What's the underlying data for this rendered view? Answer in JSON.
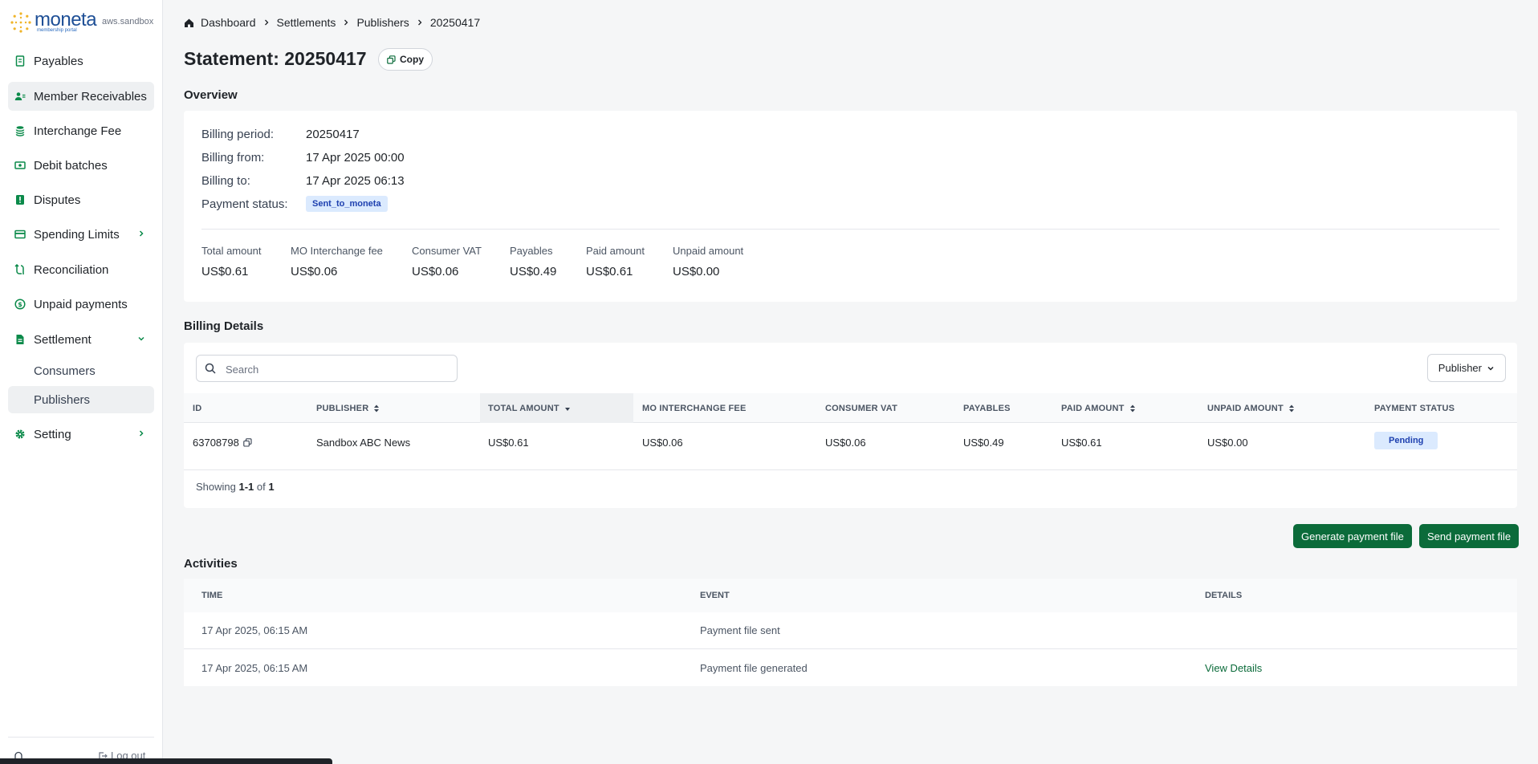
{
  "app": {
    "logo_text": "moneta",
    "logo_subtitle": "membership portal",
    "environment": "aws.sandbox"
  },
  "sidebar": {
    "items": [
      {
        "label": "Payables",
        "icon": "receipt-icon"
      },
      {
        "label": "Member Receivables",
        "icon": "users-icon",
        "active": true
      },
      {
        "label": "Interchange Fee",
        "icon": "coins-icon"
      },
      {
        "label": "Debit batches",
        "icon": "banknote-icon"
      },
      {
        "label": "Disputes",
        "icon": "alert-icon"
      },
      {
        "label": "Spending Limits",
        "icon": "credit-card-icon",
        "chevron": "right"
      },
      {
        "label": "Reconciliation",
        "icon": "arrows-icon"
      },
      {
        "label": "Unpaid payments",
        "icon": "dollar-circle-icon"
      },
      {
        "label": "Settlement",
        "icon": "document-icon",
        "chevron": "down"
      },
      {
        "label": "Setting",
        "icon": "gear-icon",
        "chevron": "right"
      }
    ],
    "settlement_sub": [
      {
        "label": "Consumers"
      },
      {
        "label": "Publishers",
        "active": true
      }
    ],
    "logout_label": "Log out"
  },
  "breadcrumb": [
    "Dashboard",
    "Settlements",
    "Publishers",
    "20250417"
  ],
  "page": {
    "title": "Statement: 20250417",
    "copy_label": "Copy"
  },
  "overview": {
    "heading": "Overview",
    "rows": [
      {
        "label": "Billing period:",
        "value": "20250417"
      },
      {
        "label": "Billing from:",
        "value": "17 Apr 2025 00:00"
      },
      {
        "label": "Billing to:",
        "value": "17 Apr 2025 06:13"
      },
      {
        "label": "Payment status:",
        "value": "Sent_to_moneta"
      }
    ],
    "metrics": [
      {
        "label": "Total amount",
        "value": "US$0.61"
      },
      {
        "label": "MO Interchange fee",
        "value": "US$0.06"
      },
      {
        "label": "Consumer VAT",
        "value": "US$0.06"
      },
      {
        "label": "Payables",
        "value": "US$0.49"
      },
      {
        "label": "Paid amount",
        "value": "US$0.61"
      },
      {
        "label": "Unpaid amount",
        "value": "US$0.00"
      }
    ]
  },
  "billing": {
    "heading": "Billing Details",
    "search_placeholder": "Search",
    "filter_label": "Publisher",
    "columns": [
      "ID",
      "PUBLISHER",
      "TOTAL AMOUNT",
      "MO INTERCHANGE FEE",
      "CONSUMER VAT",
      "PAYABLES",
      "PAID AMOUNT",
      "UNPAID AMOUNT",
      "PAYMENT STATUS"
    ],
    "rows": [
      {
        "id": "63708798",
        "publisher": "Sandbox ABC News",
        "total": "US$0.61",
        "interchange": "US$0.06",
        "vat": "US$0.06",
        "payables": "US$0.49",
        "paid": "US$0.61",
        "unpaid": "US$0.00",
        "status": "Pending"
      }
    ],
    "showing_prefix": "Showing",
    "showing_range": "1-1",
    "showing_of": "of",
    "showing_total": "1"
  },
  "actions": {
    "generate_label": "Generate payment file",
    "send_label": "Send payment file"
  },
  "activities": {
    "heading": "Activities",
    "columns": [
      "TIME",
      "EVENT",
      "DETAILS"
    ],
    "rows": [
      {
        "time": "17 Apr 2025, 06:15 AM",
        "event": "Payment file sent",
        "details": ""
      },
      {
        "time": "17 Apr 2025, 06:15 AM",
        "event": "Payment file generated",
        "details": "View Details"
      }
    ]
  },
  "colors": {
    "accent_green": "#0b6b3a",
    "badge_blue_bg": "#dbeafe",
    "brand_blue": "#1e4f96"
  }
}
